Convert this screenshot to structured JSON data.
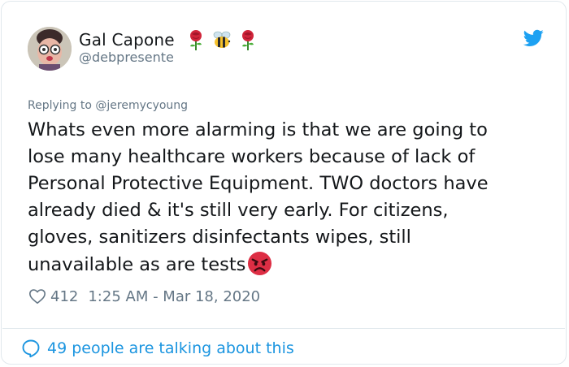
{
  "tweet": {
    "author": {
      "display_name": "Gal Capone",
      "handle": "@debpresente",
      "name_emojis": [
        "rose-emoji",
        "bee-emoji",
        "rose-emoji"
      ]
    },
    "reply_context": {
      "prefix": "Replying to",
      "mention": "@jeremycyoung"
    },
    "text_lines": [
      "Whats even more alarming is that we are going to",
      "lose many healthcare workers because of lack of",
      "Personal Protective Equipment. TWO doctors  have",
      "already died & it's still very early. For citizens,",
      "gloves, sanitizers disinfectants wipes, still",
      "unavailable as are tests"
    ],
    "trailing_emoji": "angry-face-emoji",
    "likes": "412",
    "timestamp": "1:25 AM - Mar 18, 2020",
    "conversation_link": "49 people are talking about this"
  },
  "colors": {
    "text": "#14171a",
    "secondary": "#657786",
    "link": "#1b95e0",
    "twitter_blue": "#1da1f2",
    "border": "#e1e8ed"
  }
}
